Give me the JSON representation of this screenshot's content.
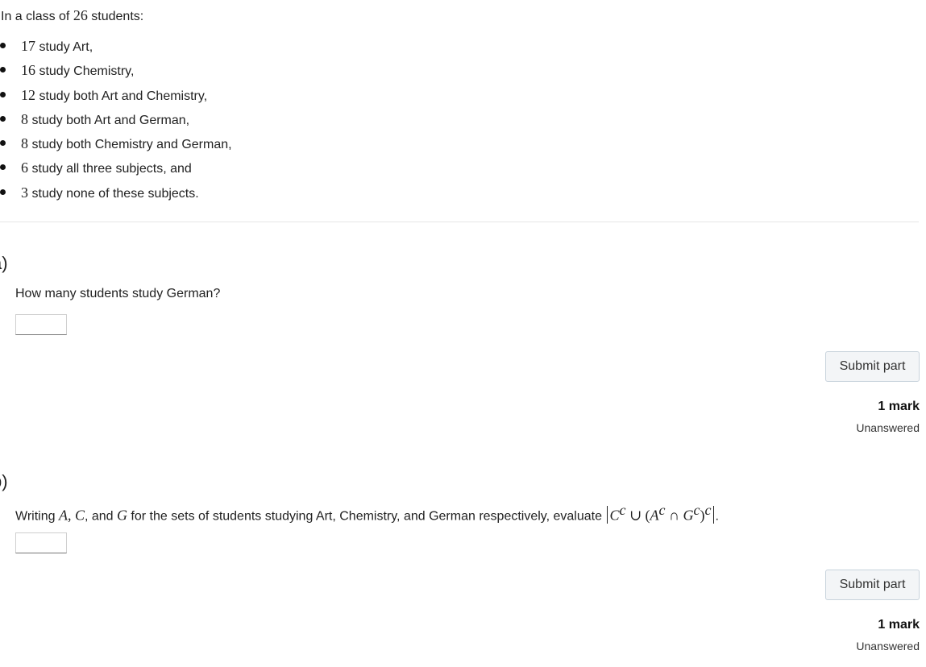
{
  "intro": {
    "prefix": "In a class of ",
    "count": "26",
    "suffix": " students:"
  },
  "bullets": [
    {
      "number": "17",
      "text": " study Art,"
    },
    {
      "number": "16",
      "text": " study Chemistry,"
    },
    {
      "number": "12",
      "text": " study both Art and Chemistry,"
    },
    {
      "number": "8",
      "text": " study both Art and German,"
    },
    {
      "number": "8",
      "text": " study both Chemistry and German,"
    },
    {
      "number": "6",
      "text": " study all three subjects, and"
    },
    {
      "number": "3",
      "text": " study none of these subjects."
    }
  ],
  "part_a": {
    "label": "a)",
    "question": "How many students study German?",
    "answer_value": "",
    "submit_label": "Submit part",
    "marks": "1 mark",
    "status": "Unanswered"
  },
  "part_b": {
    "label": "b)",
    "question_prefix": "Writing ",
    "var_a": "A",
    "sep1": ", ",
    "var_c": "C",
    "sep2": ", and ",
    "var_g": "G",
    "question_mid": " for the sets of students studying Art, Chemistry, and German respectively, evaluate ",
    "expr_c": "C",
    "expr_union": " ∪ (",
    "expr_a": "A",
    "expr_cap": " ∩ ",
    "expr_g": "G",
    "expr_close": ")",
    "complement": "c",
    "question_end": ".",
    "answer_value": "",
    "submit_label": "Submit part",
    "marks": "1 mark",
    "status": "Unanswered"
  }
}
